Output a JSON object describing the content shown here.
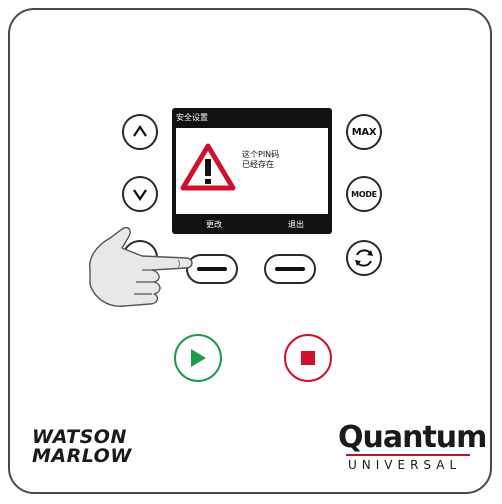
{
  "screen": {
    "title": "安全设置",
    "message_line1": "这个PIN码",
    "message_line2": "已经存在",
    "softkey_left": "更改",
    "softkey_right": "退出"
  },
  "buttons": {
    "max_label": "MAX",
    "mode_label": "MODE"
  },
  "branding": {
    "wm_line1": "WATSON",
    "wm_line2": "MARLOW",
    "product_name": "Quantum",
    "product_sub": "UNIVERSAL"
  },
  "colors": {
    "start_green": "#1f9a4a",
    "stop_red": "#d0102a",
    "warning_red": "#d0102a",
    "screen_black": "#111111"
  }
}
